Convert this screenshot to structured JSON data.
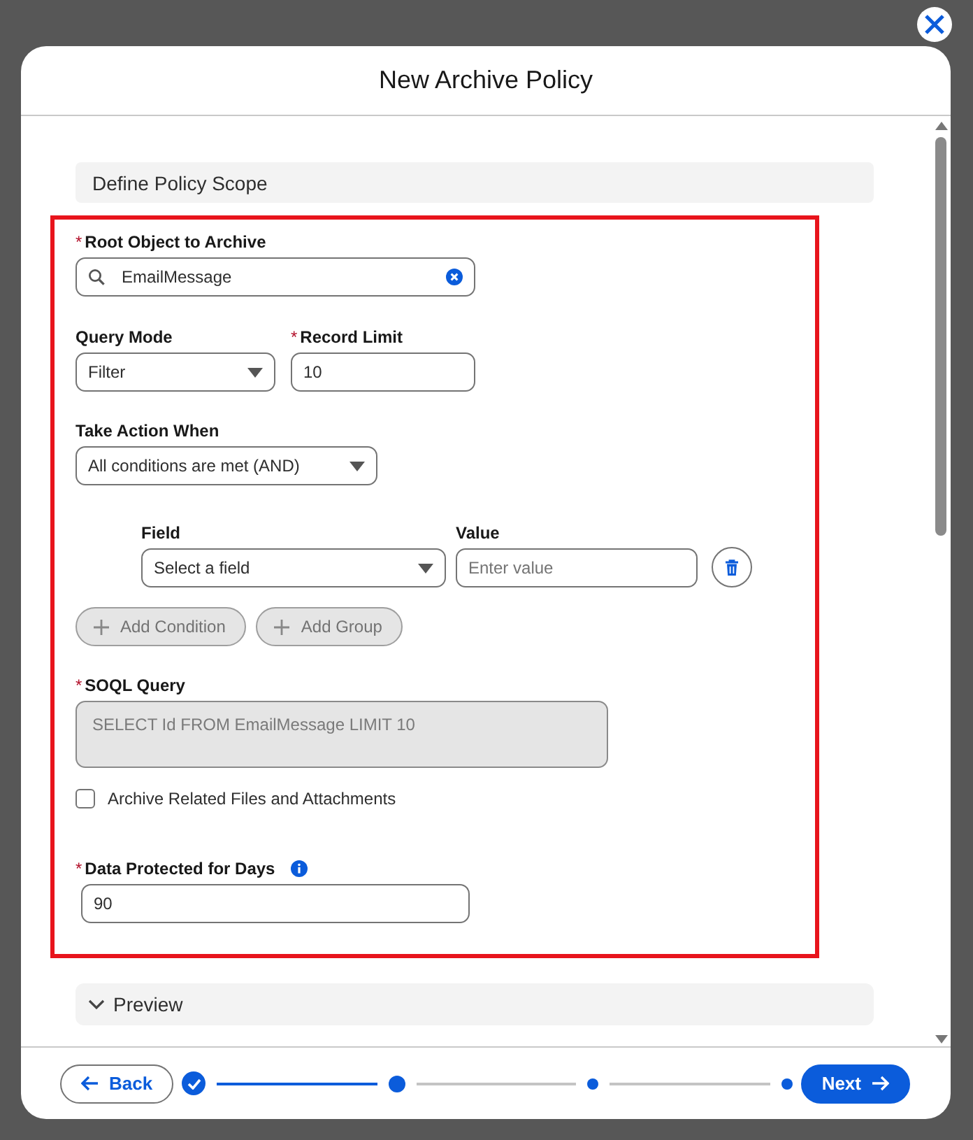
{
  "dialog": {
    "title": "New Archive Policy"
  },
  "section": {
    "title": "Define Policy Scope",
    "highlighted": true
  },
  "root_object": {
    "marker": "*",
    "label": "Root Object to Archive",
    "value": "EmailMessage"
  },
  "query_mode": {
    "label": "Query Mode",
    "value": "Filter"
  },
  "record_limit": {
    "marker": "*",
    "label": "Record Limit",
    "value": "10"
  },
  "take_action": {
    "label": "Take Action When",
    "value": "All conditions are met (AND)"
  },
  "condition": {
    "field_label": "Field",
    "field_placeholder": "Select a field",
    "value_label": "Value",
    "value_placeholder": "Enter value"
  },
  "condition_buttons": [
    "Add Condition",
    "Add Group"
  ],
  "soql": {
    "marker": "*",
    "label": "SOQL Query",
    "value": "SELECT Id FROM EmailMessage LIMIT 10",
    "disabled": true
  },
  "archive_files": {
    "label": "Archive Related Files and Attachments",
    "checked": false
  },
  "protected_days": {
    "marker": "*",
    "label": "Data Protected for Days",
    "value": "90"
  },
  "preview": {
    "title": "Preview",
    "expanded": false
  },
  "footer": {
    "back": "Back",
    "next": "Next",
    "steps": [
      {
        "completed": true,
        "selected": false
      },
      {
        "completed": false,
        "selected": true
      },
      {
        "completed": false,
        "selected": false
      },
      {
        "completed": false,
        "selected": false
      }
    ]
  }
}
